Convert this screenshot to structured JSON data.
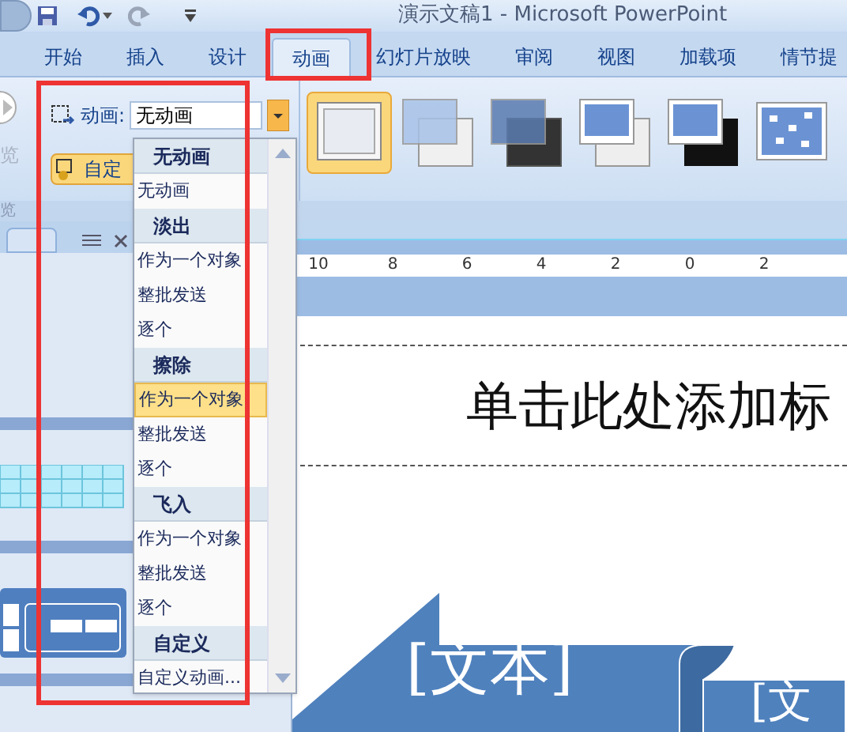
{
  "window": {
    "title": "演示文稿1 - Microsoft PowerPoint"
  },
  "ribbon_tabs": [
    {
      "label": "开始",
      "selected": false
    },
    {
      "label": "插入",
      "selected": false
    },
    {
      "label": "设计",
      "selected": false
    },
    {
      "label": "动画",
      "selected": true
    },
    {
      "label": "幻灯片放映",
      "selected": false
    },
    {
      "label": "审阅",
      "selected": false
    },
    {
      "label": "视图",
      "selected": false
    },
    {
      "label": "加载项",
      "selected": false
    },
    {
      "label": "情节提",
      "selected": false
    }
  ],
  "preview_button": {
    "label": "览"
  },
  "group_label": "览",
  "animation_group": {
    "label": "动画:",
    "value": "无动画",
    "custom_button": "自定"
  },
  "transition_gallery": [
    {
      "kind": "blank",
      "selected": true
    },
    {
      "kind": "fade",
      "selected": false
    },
    {
      "kind": "fade_dark",
      "selected": false
    },
    {
      "kind": "push",
      "selected": false
    },
    {
      "kind": "push_black",
      "selected": false
    },
    {
      "kind": "dissolve",
      "selected": false
    }
  ],
  "dropdown": {
    "items": [
      {
        "kind": "header",
        "label": "无动画"
      },
      {
        "kind": "item",
        "label": "无动画",
        "selected": false
      },
      {
        "kind": "header",
        "label": "淡出"
      },
      {
        "kind": "item",
        "label": "作为一个对象",
        "selected": false
      },
      {
        "kind": "item",
        "label": "整批发送",
        "selected": false
      },
      {
        "kind": "item",
        "label": "逐个",
        "selected": false
      },
      {
        "kind": "header",
        "label": "擦除"
      },
      {
        "kind": "item",
        "label": "作为一个对象",
        "selected": true
      },
      {
        "kind": "item",
        "label": "整批发送",
        "selected": false
      },
      {
        "kind": "item",
        "label": "逐个",
        "selected": false
      },
      {
        "kind": "header",
        "label": "飞入"
      },
      {
        "kind": "item",
        "label": "作为一个对象",
        "selected": false
      },
      {
        "kind": "item",
        "label": "整批发送",
        "selected": false
      },
      {
        "kind": "item",
        "label": "逐个",
        "selected": false
      },
      {
        "kind": "header",
        "label": "自定义"
      },
      {
        "kind": "item",
        "label": "自定义动画...",
        "selected": false
      }
    ]
  },
  "ruler": {
    "labels": [
      "10",
      "8",
      "6",
      "4",
      "2",
      "0",
      "2"
    ]
  },
  "slide": {
    "title_placeholder": "单击此处添加标",
    "shapes": [
      {
        "text": "[文本]"
      },
      {
        "text": "[文"
      }
    ]
  }
}
